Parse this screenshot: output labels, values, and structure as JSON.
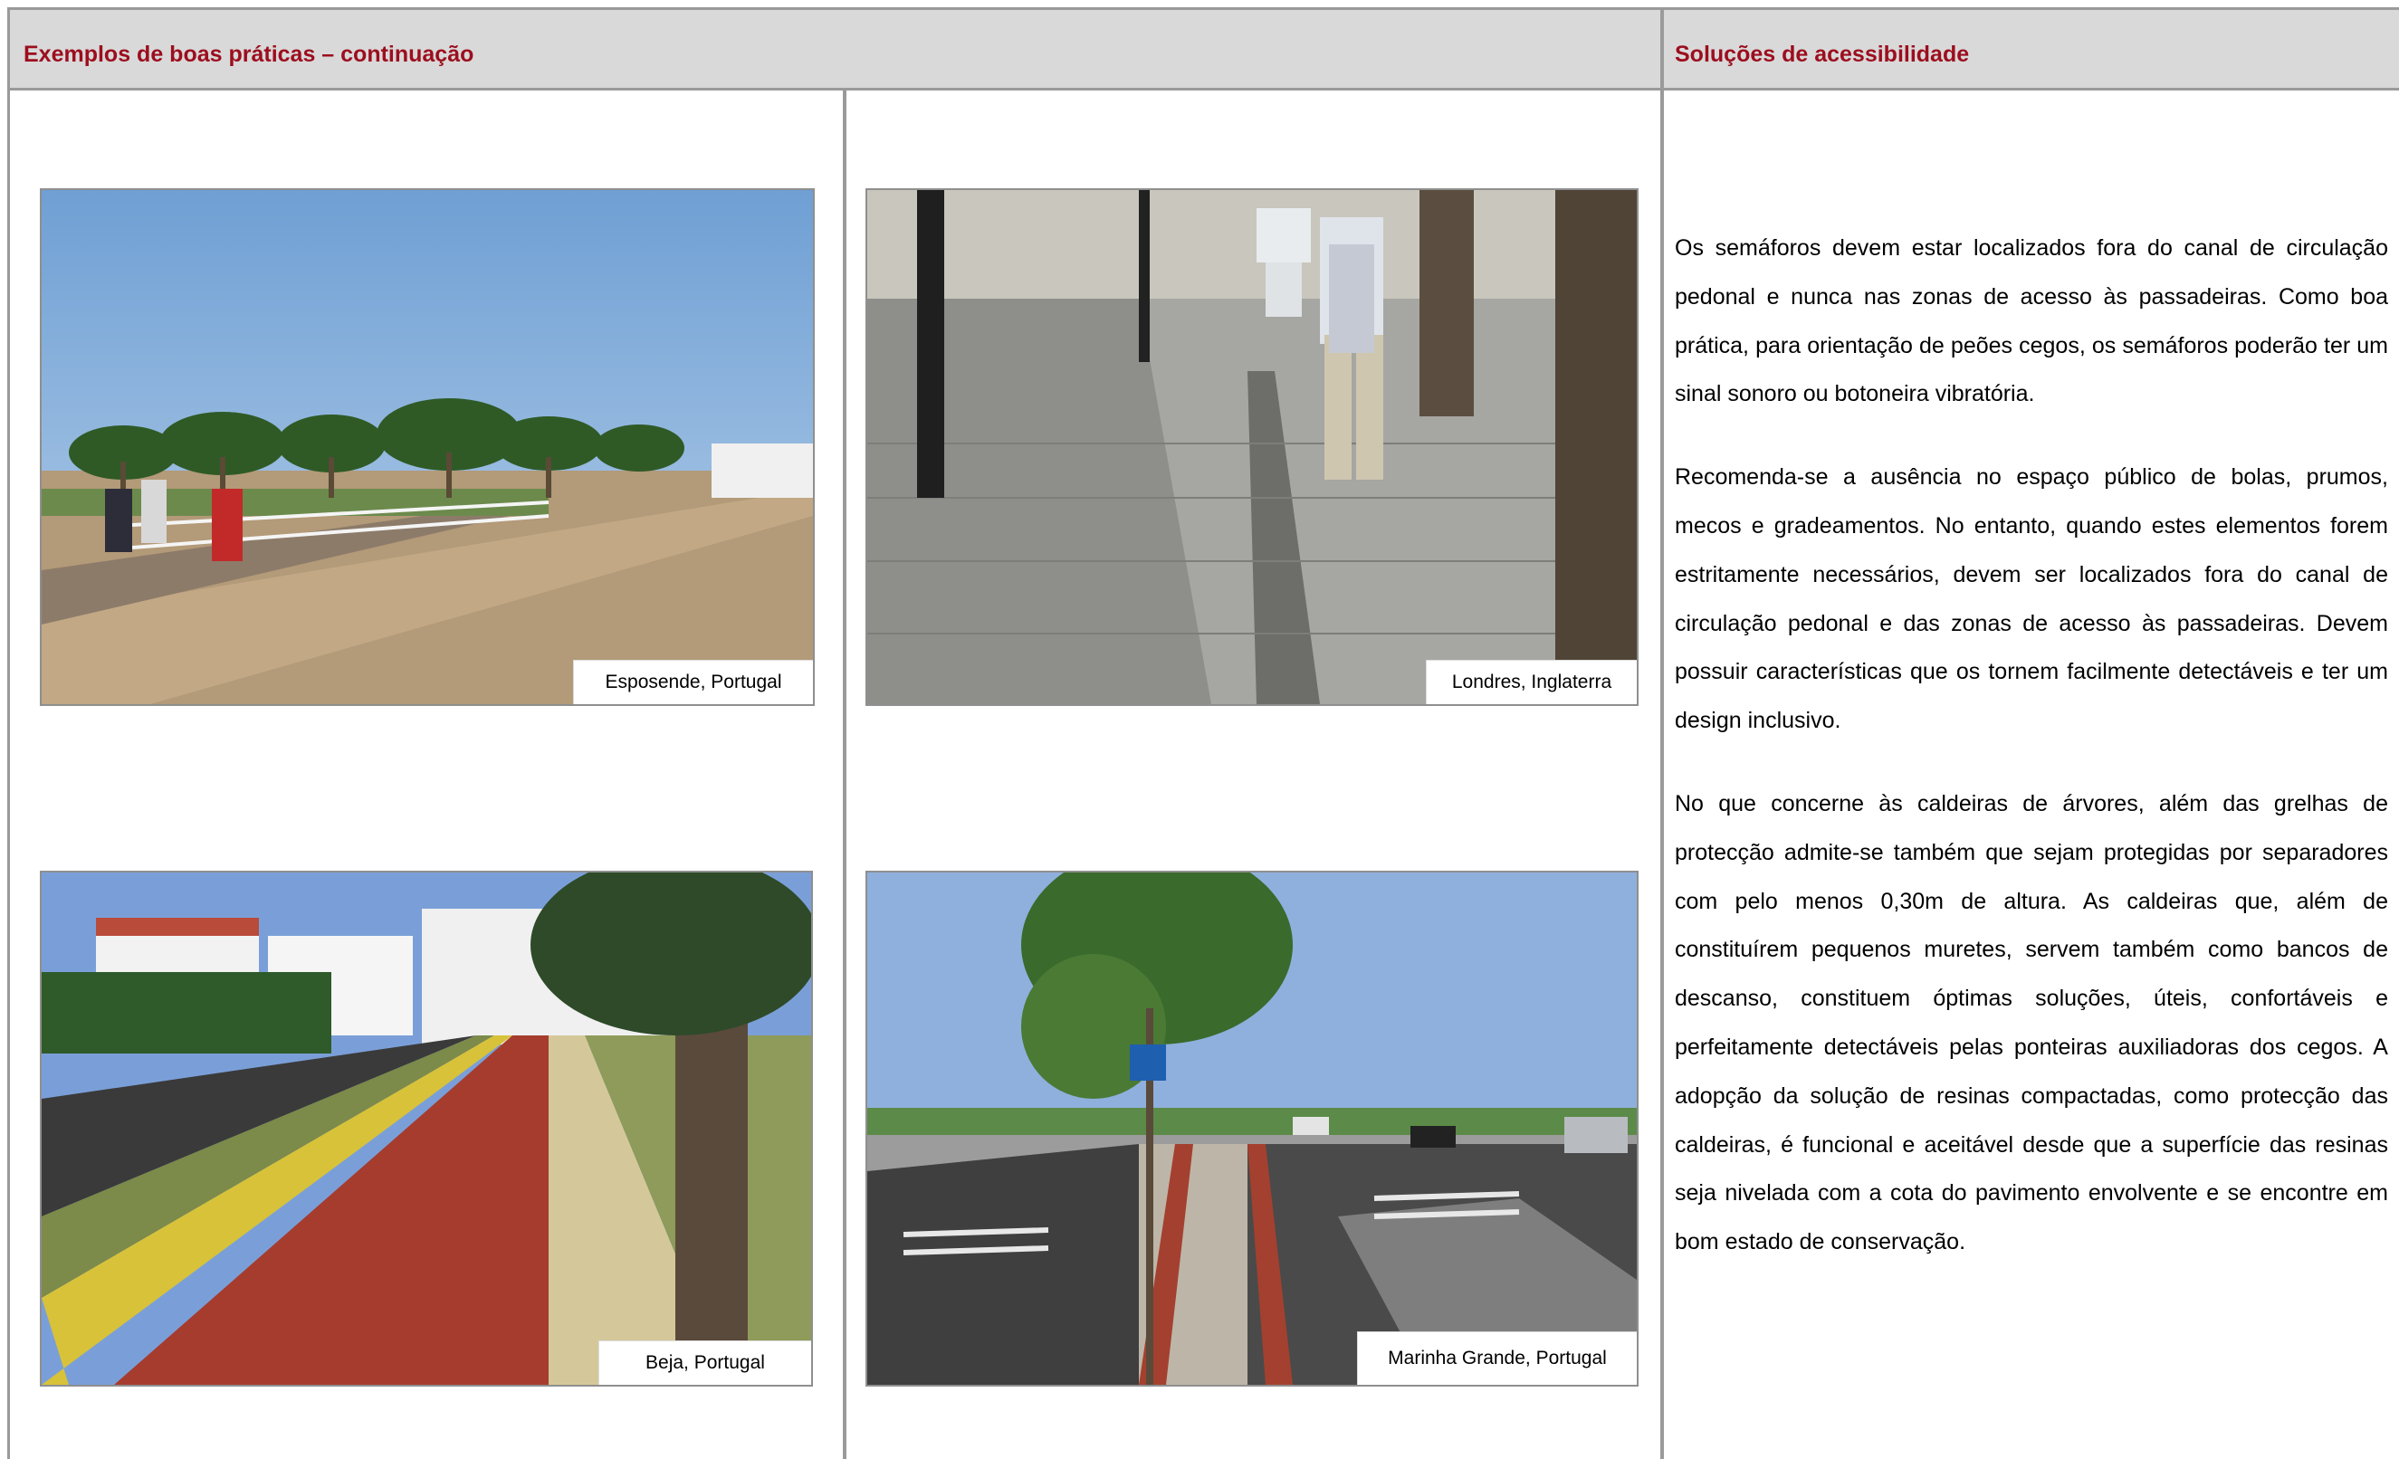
{
  "header": {
    "left_title": "Exemplos de boas práticas – continuação",
    "right_title": "Soluções de acessibilidade"
  },
  "photos": [
    {
      "caption": "Esposende, Portugal"
    },
    {
      "caption": "Londres, Inglaterra"
    },
    {
      "caption": "Beja, Portugal"
    },
    {
      "caption": "Marinha Grande, Portugal"
    }
  ],
  "text": {
    "paragraphs": [
      "Os semáforos devem estar localizados fora do canal de circulação pedonal e nunca nas zonas de acesso às passadeiras. Como boa prática, para orientação de peões cegos, os semáforos poderão ter um sinal sonoro ou botoneira vibratória.",
      "Recomenda-se a ausência no espaço público de bolas, prumos, mecos e gradeamentos. No entanto, quando estes elementos forem estritamente necessários, devem ser localizados fora do canal de circulação pedonal e das zonas de acesso às passadeiras. Devem possuir características que os tornem facilmente detectáveis e ter um design inclusivo.",
      "No que concerne às caldeiras de árvores, além das grelhas de protecção admite-se também que sejam protegidas por separadores com pelo menos 0,30m de altura. As caldeiras que, além de constituírem pequenos muretes, servem também como bancos de descanso, constituem óptimas soluções, úteis, confortáveis e perfeitamente detectáveis pelas ponteiras auxiliadoras dos cegos. A adopção da solução de resinas compactadas, como protecção das caldeiras, é funcional e aceitável desde que a superfície das resinas seja nivelada com a cota do pavimento envolvente e se encontre em bom estado de conservação."
    ]
  }
}
